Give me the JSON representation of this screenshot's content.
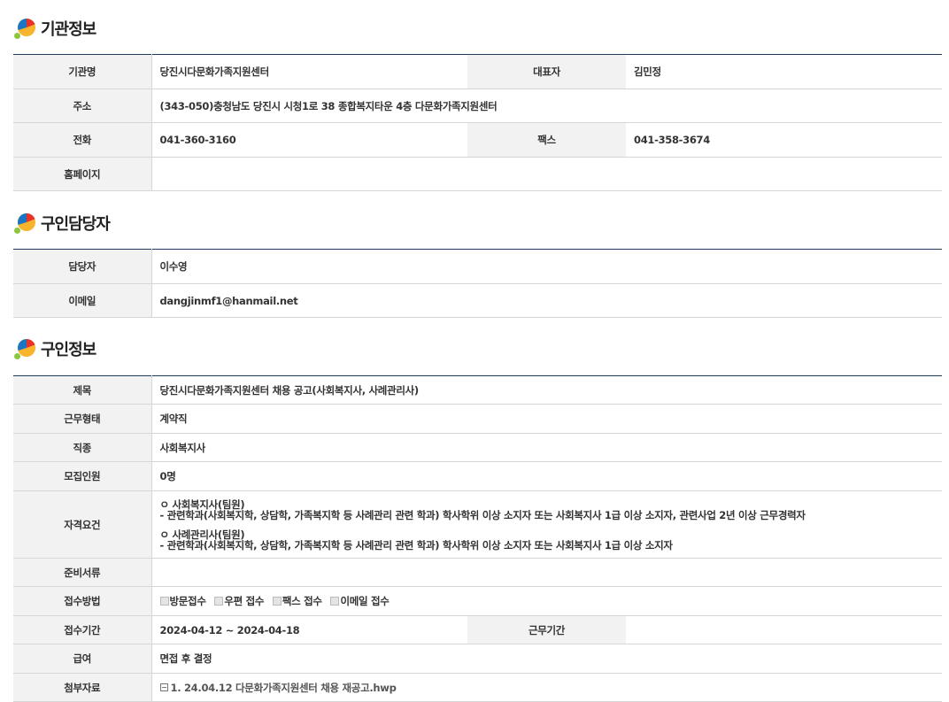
{
  "org": {
    "title": "기관정보",
    "name_label": "기관명",
    "name": "당진시다문화가족지원센터",
    "ceo_label": "대표자",
    "ceo": "김민정",
    "address_label": "주소",
    "address": "(343-050)충청남도 당진시 시청1로 38 종합복지타운 4층 다문화가족지원센터",
    "phone_label": "전화",
    "phone": "041-360-3160",
    "fax_label": "팩스",
    "fax": "041-358-3674",
    "homepage_label": "홈페이지",
    "homepage": ""
  },
  "contact": {
    "title": "구인담당자",
    "person_label": "담당자",
    "person": "이수영",
    "email_label": "이메일",
    "email": "dangjinmf1@hanmail.net"
  },
  "job": {
    "title": "구인정보",
    "subject_label": "제목",
    "subject": "당진시다문화가족지원센터 채용 공고(사회복지사, 사례관리사)",
    "employment_label": "근무형태",
    "employment": "계약직",
    "occupation_label": "직종",
    "occupation": "사회복지사",
    "headcount_label": "모집인원",
    "headcount": "0명",
    "qualification_label": "자격요건",
    "qualifications": [
      "ㅇ 사회복지사(팀원)",
      "- 관련학과(사회복지학, 상담학, 가족복지학 등 사례관리 관련 학과) 학사학위 이상 소지자 또는 사회복지사 1급 이상 소지자, 관련사업 2년 이상 근무경력자",
      "ㅇ 사례관리사(팀원)",
      "- 관련학과(사회복지학, 상담학, 가족복지학 등 사례관리 관련 학과) 학사학위 이상 소지자 또는 사회복지사 1급 이상 소지자"
    ],
    "documents_label": "준비서류",
    "documents": "",
    "method_label": "접수방법",
    "methods": [
      "방문접수",
      "우편 접수",
      "팩스 접수",
      "이메일 접수"
    ],
    "period_label": "접수기간",
    "period": "2024-04-12 ~ 2024-04-18",
    "work_period_label": "근무기간",
    "work_period": "",
    "salary_label": "급여",
    "salary": "면접 후 결정",
    "attachment_label": "첨부자료",
    "attachment": "1. 24.04.12  다문화가족지원센터 채용 재공고.hwp"
  },
  "colors": {
    "table_top_border": "#1f3b5a",
    "header_bg": "#f2f2f2",
    "icon_red": "#e8332a",
    "icon_yellow": "#f7b42c",
    "icon_blue": "#1a75c2",
    "icon_green": "#8cc63f"
  }
}
